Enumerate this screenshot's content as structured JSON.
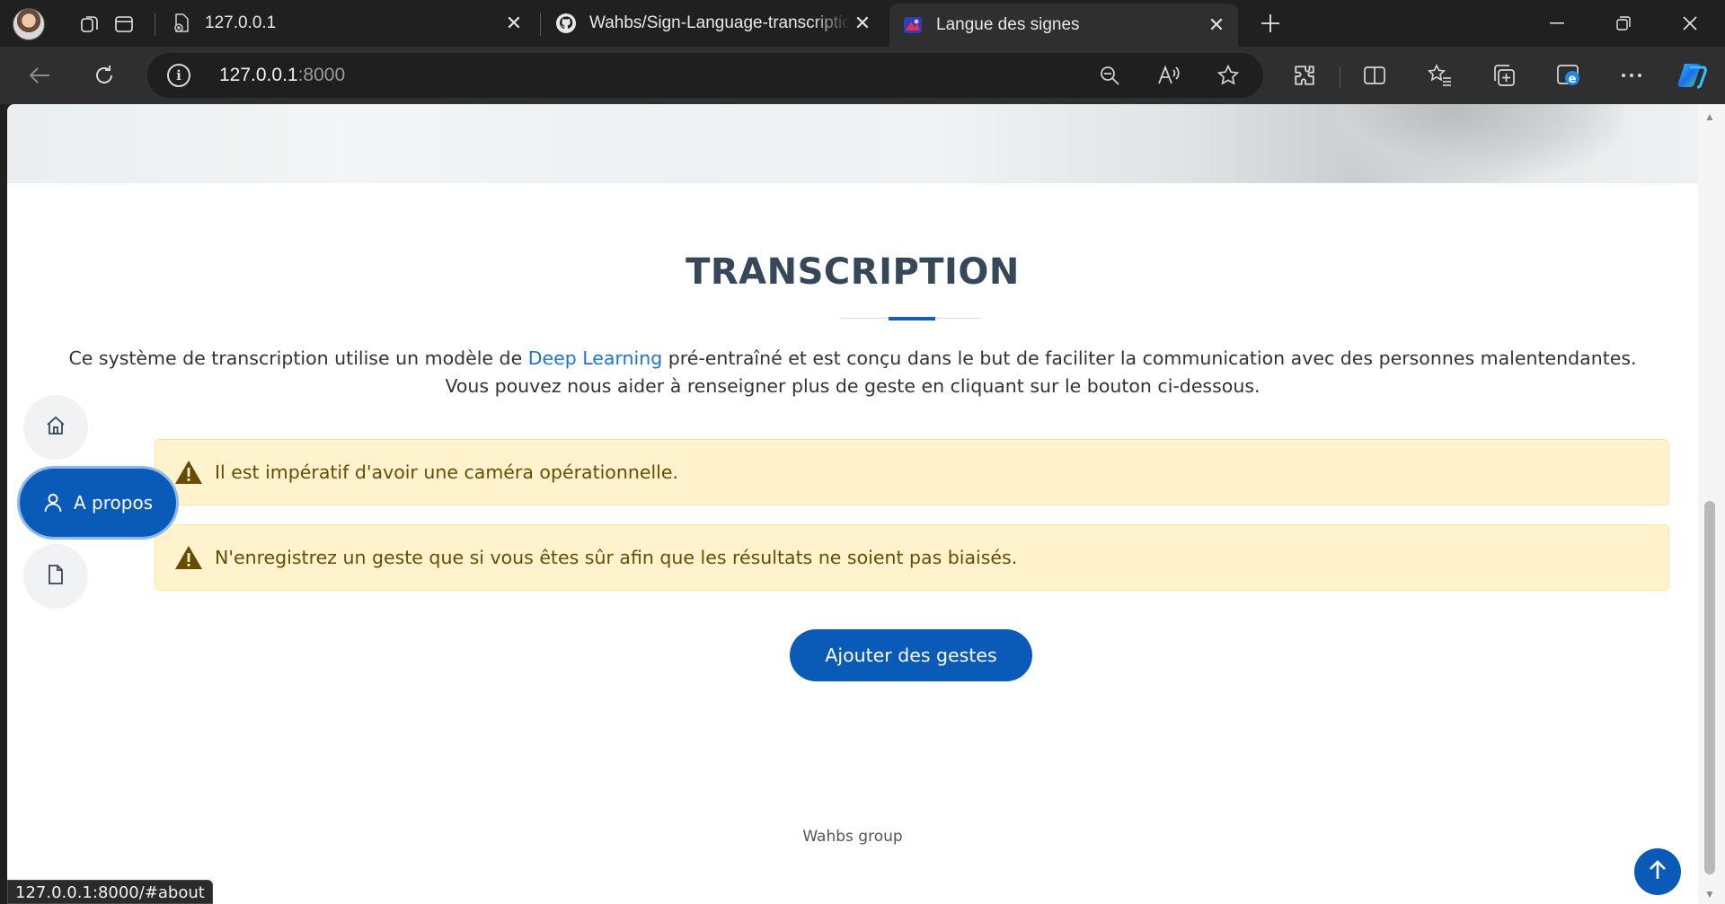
{
  "browser": {
    "tabs": [
      {
        "title": "127.0.0.1",
        "active": false
      },
      {
        "title": "Wahbs/Sign-Language-transcription",
        "active": false
      },
      {
        "title": "Langue des signes",
        "active": true
      }
    ],
    "url_host": "127.0.0.1",
    "url_port": ":8000",
    "status_url": "127.0.0.1:8000/#about"
  },
  "page": {
    "title": "TRANSCRIPTION",
    "intro_before": "Ce système de transcription utilise un modèle de ",
    "intro_link": "Deep Learning",
    "intro_after": " pré-entraîné et est conçu dans le but de faciliter la communication avec des personnes malentendantes.",
    "intro_line2": "Vous pouvez nous aider à renseigner plus de geste en cliquant sur le bouton ci-dessous.",
    "alerts": [
      "Il est impératif d'avoir une caméra opérationnelle.",
      "N'enregistrez un geste que si vous êtes sûr afin que les résultats ne soient pas biaisés."
    ],
    "cta_label": "Ajouter des gestes",
    "footer": "Wahbs group"
  },
  "sidenav": {
    "active_label": "A propos",
    "items": [
      "home-icon",
      "user-icon",
      "file-icon"
    ]
  },
  "colors": {
    "accent": "#0a5bb8",
    "title": "#37475a",
    "alert_bg": "#fff3cd",
    "alert_text": "#664d03"
  }
}
